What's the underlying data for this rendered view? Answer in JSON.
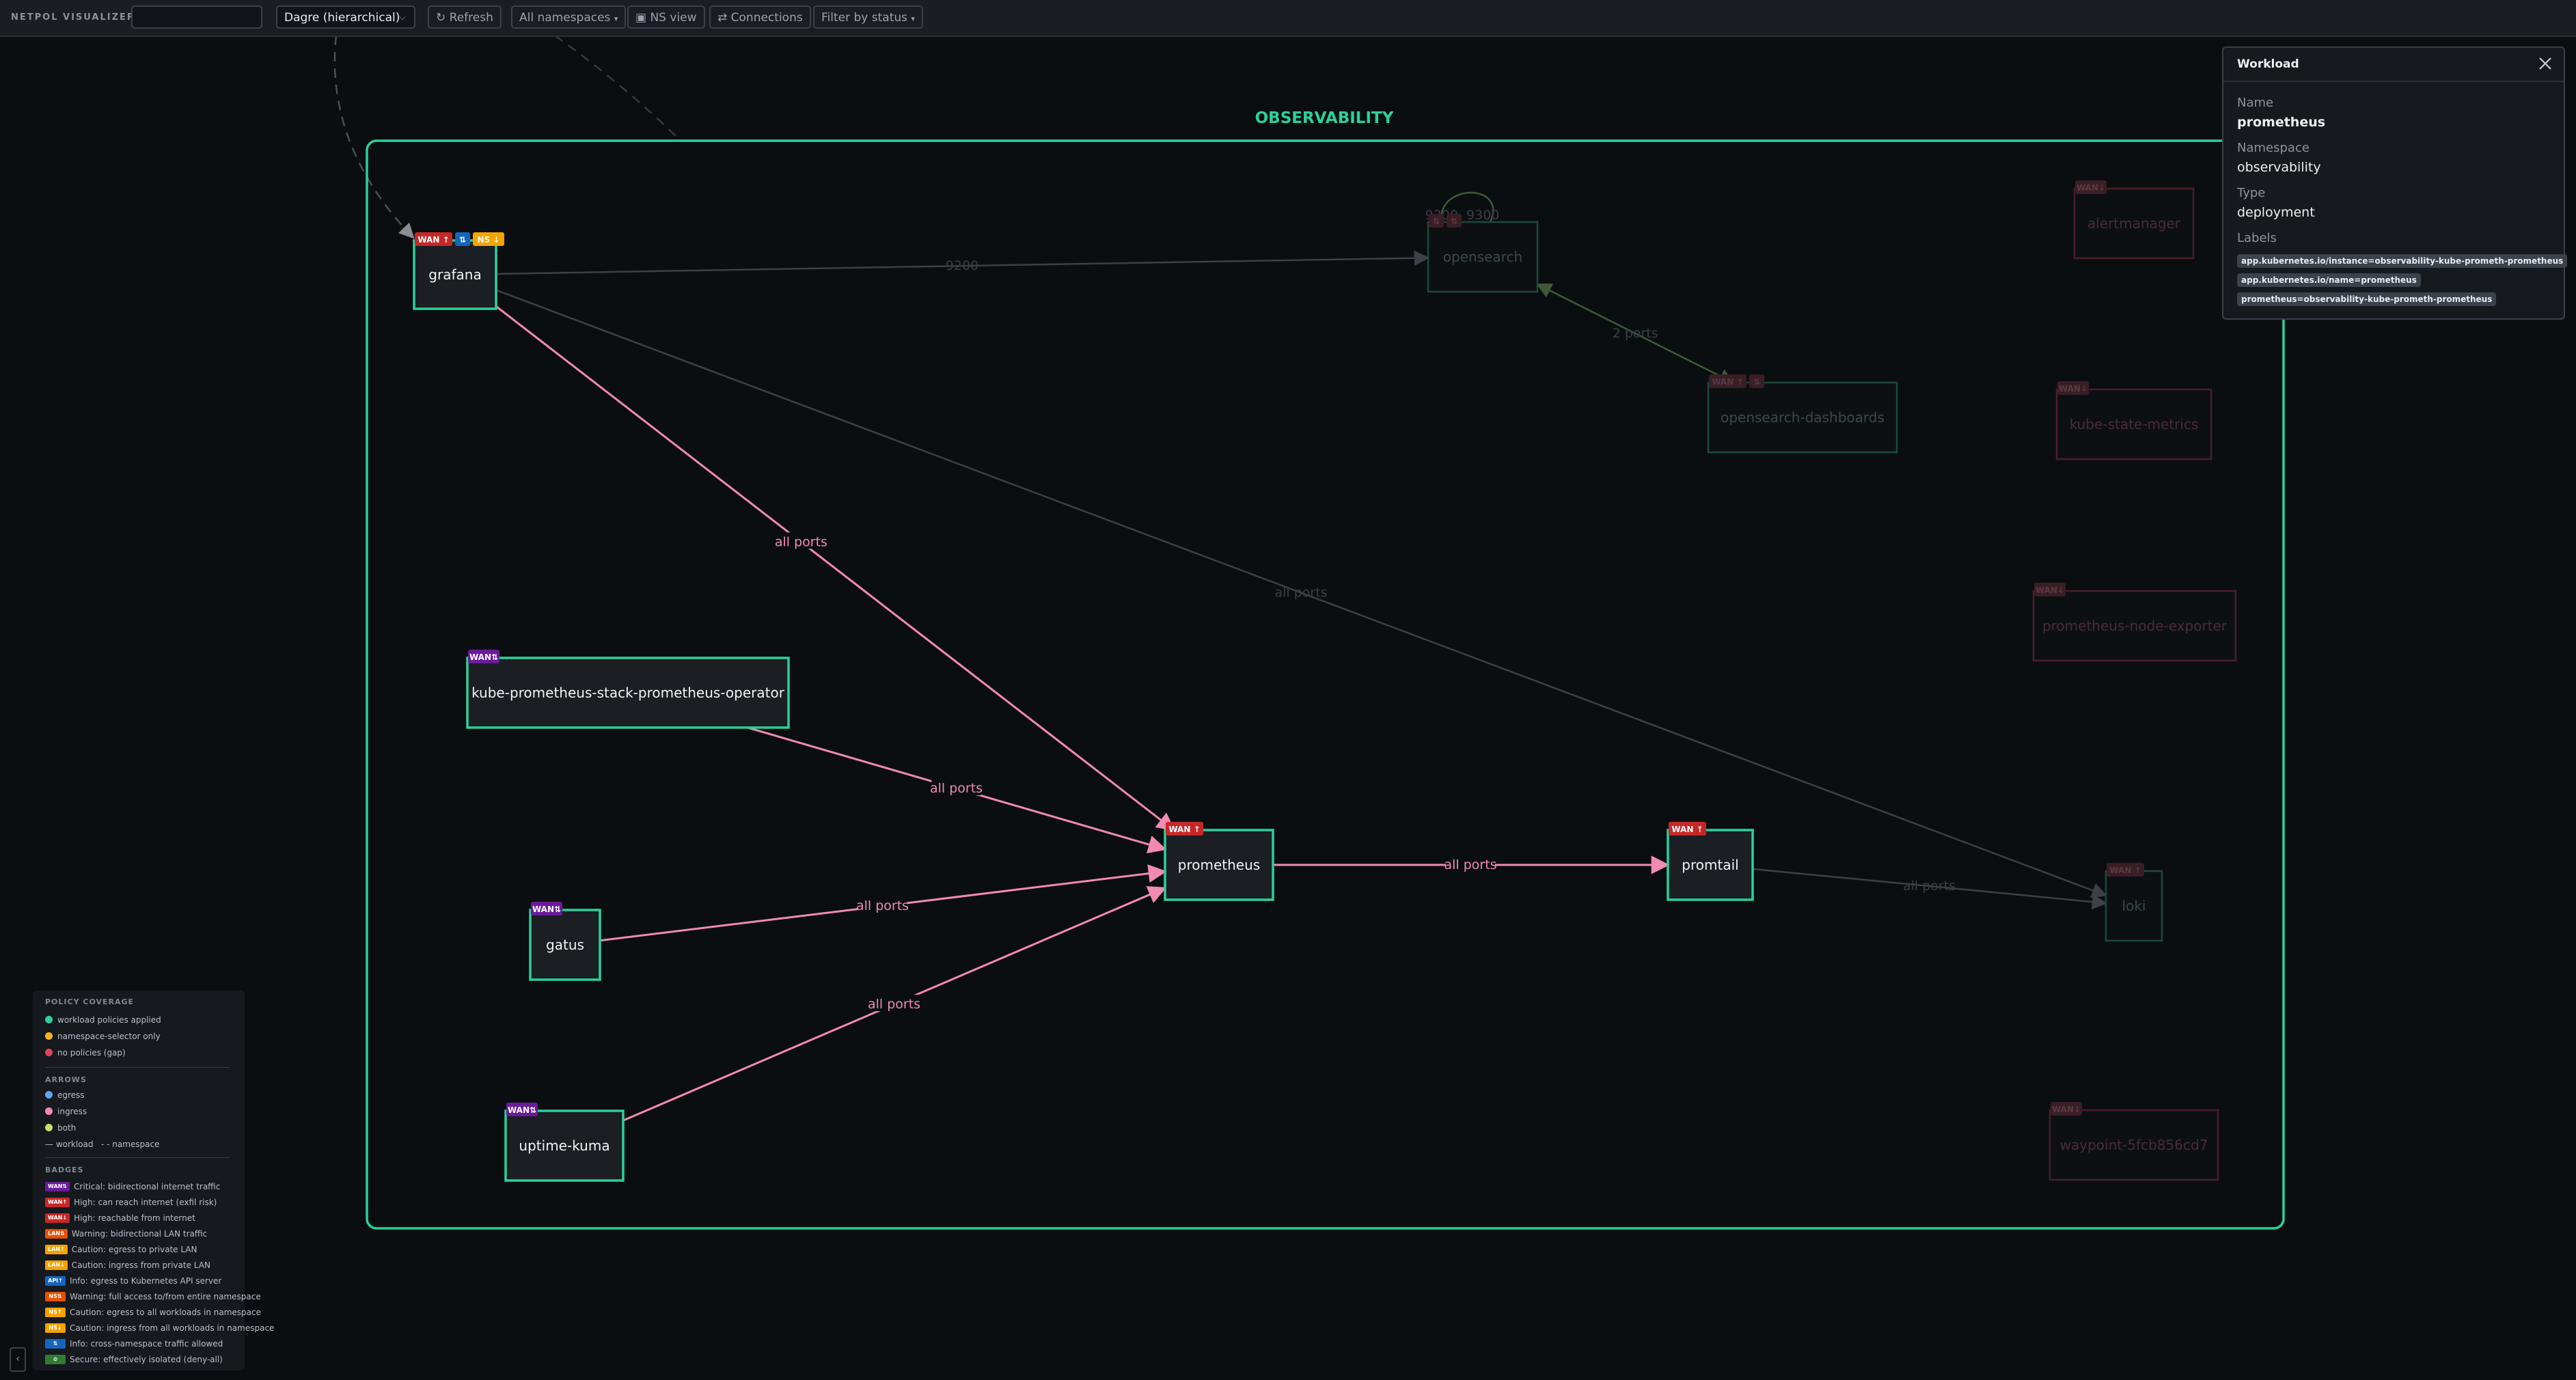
{
  "app": {
    "title": "NETPOL VISUALIZER"
  },
  "toolbar": {
    "search_value": "",
    "search_placeholder": "",
    "layout_value": "Dagre (hierarchical)",
    "refresh_label": "↻ Refresh",
    "namespaces_label": "All namespaces",
    "ns_view_label": "▣ NS view",
    "connections_label": "⇄ Connections",
    "filter_label": "Filter by status"
  },
  "graph": {
    "namespace_title": "OBSERVABILITY",
    "nodes": [
      {
        "id": "grafana",
        "label": "grafana",
        "state": "active",
        "badges": [
          {
            "text": "WAN ↑",
            "color": "#c62828"
          },
          {
            "text": "⇅",
            "color": "#1565c0"
          },
          {
            "text": "NS ↓",
            "color": "#f5a300"
          }
        ]
      },
      {
        "id": "operator",
        "label": "kube-prometheus-stack-prometheus-operator",
        "state": "active",
        "badges": [
          {
            "text": "WAN⇅",
            "color": "#6a1b9a"
          }
        ]
      },
      {
        "id": "gatus",
        "label": "gatus",
        "state": "active",
        "badges": [
          {
            "text": "WAN⇅",
            "color": "#6a1b9a"
          }
        ]
      },
      {
        "id": "uptime",
        "label": "uptime-kuma",
        "state": "active",
        "badges": [
          {
            "text": "WAN⇅",
            "color": "#6a1b9a"
          }
        ]
      },
      {
        "id": "prometheus",
        "label": "prometheus",
        "state": "active",
        "badges": [
          {
            "text": "WAN ↑",
            "color": "#c62828"
          }
        ]
      },
      {
        "id": "promtail",
        "label": "promtail",
        "state": "active",
        "badges": [
          {
            "text": "WAN ↑",
            "color": "#c62828"
          }
        ]
      },
      {
        "id": "opensearch",
        "label": "opensearch",
        "state": "dim",
        "badges": [
          {
            "text": "⇅",
            "color": "#2e7d32"
          },
          {
            "text": "⇅",
            "color": "#1565c0"
          }
        ]
      },
      {
        "id": "osd",
        "label": "opensearch-dashboards",
        "state": "dim",
        "badges": [
          {
            "text": "WAN ↑",
            "color": "#c62828"
          },
          {
            "text": "⇅",
            "color": "#1565c0"
          }
        ]
      },
      {
        "id": "alertmanager",
        "label": "alertmanager",
        "state": "dim-red",
        "badges": [
          {
            "text": "WAN↓",
            "color": "#7b1f3a"
          }
        ]
      },
      {
        "id": "ksm",
        "label": "kube-state-metrics",
        "state": "dim-red",
        "badges": [
          {
            "text": "WAN↓",
            "color": "#7b1f3a"
          }
        ]
      },
      {
        "id": "nodeexp",
        "label": "prometheus-node-exporter",
        "state": "dim-red",
        "badges": [
          {
            "text": "WAN↓",
            "color": "#7b1f3a"
          }
        ]
      },
      {
        "id": "loki",
        "label": "loki",
        "state": "dim",
        "badges": [
          {
            "text": "WAN ↑",
            "color": "#7b1f3a"
          }
        ]
      },
      {
        "id": "waypoint",
        "label": "waypoint-5fcb856cd7",
        "state": "dim-red",
        "badges": [
          {
            "text": "WAN↓",
            "color": "#7b1f3a"
          }
        ]
      }
    ],
    "edges": [
      {
        "from": "grafana",
        "to": "prometheus",
        "label": "all ports",
        "state": "active"
      },
      {
        "from": "operator",
        "to": "prometheus",
        "label": "all ports",
        "state": "active"
      },
      {
        "from": "gatus",
        "to": "prometheus",
        "label": "all ports",
        "state": "active"
      },
      {
        "from": "uptime",
        "to": "prometheus",
        "label": "all ports",
        "state": "active"
      },
      {
        "from": "prometheus",
        "to": "promtail",
        "label": "all ports",
        "state": "active"
      },
      {
        "from": "grafana",
        "to": "opensearch",
        "label": "9200",
        "state": "dim"
      },
      {
        "from": "grafana",
        "to": "loki",
        "label": "all ports",
        "state": "dim"
      },
      {
        "from": "promtail",
        "to": "loki",
        "label": "all ports",
        "state": "dim"
      },
      {
        "from": "opensearch",
        "to": "osd",
        "label": "2 ports",
        "state": "dim"
      },
      {
        "from": "opensearch",
        "to": "opensearch",
        "label": "9200, 9300",
        "state": "dim"
      }
    ]
  },
  "details": {
    "title": "Workload",
    "name_label": "Name",
    "name_value": "prometheus",
    "namespace_label": "Namespace",
    "namespace_value": "observability",
    "type_label": "Type",
    "type_value": "deployment",
    "labels_label": "Labels",
    "labels": [
      "app.kubernetes.io/instance=observability-kube-prometh-prometheus",
      "app.kubernetes.io/name=prometheus",
      "prometheus=observability-kube-prometh-prometheus"
    ]
  },
  "legend": {
    "policy_title": "POLICY COVERAGE",
    "policy_items": [
      {
        "color": "#2bd19a",
        "text": "workload policies applied"
      },
      {
        "color": "#f5b41e",
        "text": "namespace-selector only"
      },
      {
        "color": "#e0445a",
        "text": "no policies (gap)"
      }
    ],
    "arrows_title": "ARROWS",
    "arrow_items": [
      {
        "color": "#5aa8f0",
        "text": "egress"
      },
      {
        "color": "#f28ab2",
        "text": "ingress"
      },
      {
        "color": "#c8e06a",
        "text": "both"
      }
    ],
    "line_workload": "— workload",
    "line_namespace": "- - namespace",
    "badges_title": "BADGES",
    "badge_items": [
      {
        "badge": "WAN⇅",
        "color": "#6a1b9a",
        "text": "Critical: bidirectional internet traffic"
      },
      {
        "badge": "WAN↑",
        "color": "#c62828",
        "text": "High: can reach internet (exfil risk)"
      },
      {
        "badge": "WAN↓",
        "color": "#c62828",
        "text": "High: reachable from internet"
      },
      {
        "badge": "LAN⇅",
        "color": "#e65100",
        "text": "Warning: bidirectional LAN traffic"
      },
      {
        "badge": "LAN↑",
        "color": "#f5a300",
        "text": "Caution: egress to private LAN"
      },
      {
        "badge": "LAN↓",
        "color": "#f5a300",
        "text": "Caution: ingress from private LAN"
      },
      {
        "badge": "API↑",
        "color": "#1565c0",
        "text": "Info: egress to Kubernetes API server"
      },
      {
        "badge": "NS⇅",
        "color": "#e65100",
        "text": "Warning: full access to/from entire namespace"
      },
      {
        "badge": "NS↑",
        "color": "#f5a300",
        "text": "Caution: egress to all workloads in namespace"
      },
      {
        "badge": "NS↓",
        "color": "#f5a300",
        "text": "Caution: ingress from all workloads in namespace"
      },
      {
        "badge": "⇅",
        "color": "#1565c0",
        "text": "Info: cross-namespace traffic allowed"
      },
      {
        "badge": "⊘",
        "color": "#2e7d32",
        "text": "Secure: effectively isolated (deny-all)"
      }
    ],
    "collapse_label": "‹"
  },
  "colors": {
    "accent": "#2bd19a",
    "ingress_arrow": "#f28ab2",
    "background": "#0b0e11",
    "node_fill": "#1b1e23"
  }
}
